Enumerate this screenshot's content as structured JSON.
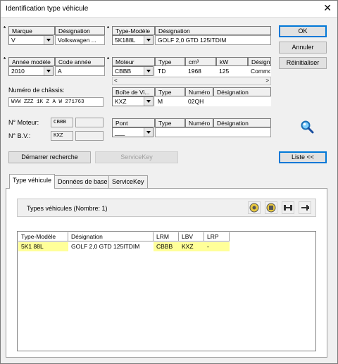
{
  "window": {
    "title": "Identification type véhicule"
  },
  "marque": {
    "hdr_marque": "Marque",
    "hdr_designation": "Désignation",
    "value": "V",
    "designation": "Volkswagen ..."
  },
  "type_modele": {
    "hdr_type": "Type-Modèle",
    "hdr_designation": "Désignation",
    "value": "5K188L",
    "designation": "GOLF 2,0 GTD 125ITDIM"
  },
  "annee": {
    "hdr_annee": "Année modèle",
    "hdr_code": "Code année",
    "value": "2010",
    "code": "A"
  },
  "moteur": {
    "hdr_moteur": "Moteur",
    "hdr_type": "Type",
    "hdr_cm3": "cm³",
    "hdr_kw": "kW",
    "hdr_designation": "Désigna",
    "value": "CBBB",
    "type": "TD",
    "cm3": "1968",
    "kw": "125",
    "designation": "Commor"
  },
  "boite": {
    "hdr_boite": "Boîte de Vi...",
    "hdr_type": "Type",
    "hdr_numero": "Numéro",
    "hdr_designation": "Désignation",
    "value": "KXZ",
    "type": "M",
    "numero": "02QH",
    "designation": ""
  },
  "pont": {
    "hdr_pont": "Pont",
    "hdr_type": "Type",
    "hdr_numero": "Numéro",
    "hdr_designation": "Désignation",
    "value": "___"
  },
  "chassis": {
    "label": "Numéro de châssis:",
    "value": "WVW ZZZ 1K Z A W 271763"
  },
  "no_moteur": {
    "label": "N° Moteur:",
    "value": "CBBB"
  },
  "no_bv": {
    "label": "N° B.V.:",
    "value": "KXZ"
  },
  "buttons": {
    "ok": "OK",
    "annuler": "Annuler",
    "reinitialiser": "Réinitialiser",
    "demarrer": "Démarrer recherche",
    "servicekey": "ServiceKey",
    "liste": "Liste <<"
  },
  "tabs": [
    {
      "label": "Type véhicule"
    },
    {
      "label": "Données de base"
    },
    {
      "label": "ServiceKey"
    }
  ],
  "types_group": {
    "label": "Types véhicules (Nombre: 1)"
  },
  "grid": {
    "headers": [
      "Type-Modèle",
      "Désignation",
      "LRM",
      "LBV",
      "LRP"
    ],
    "rows": [
      {
        "type_modele": "5K1 88L",
        "designation": "GOLF 2,0 GTD 125ITDIM",
        "lrm": "CBBB",
        "lbv": "KXZ",
        "lrp": "-"
      }
    ]
  }
}
